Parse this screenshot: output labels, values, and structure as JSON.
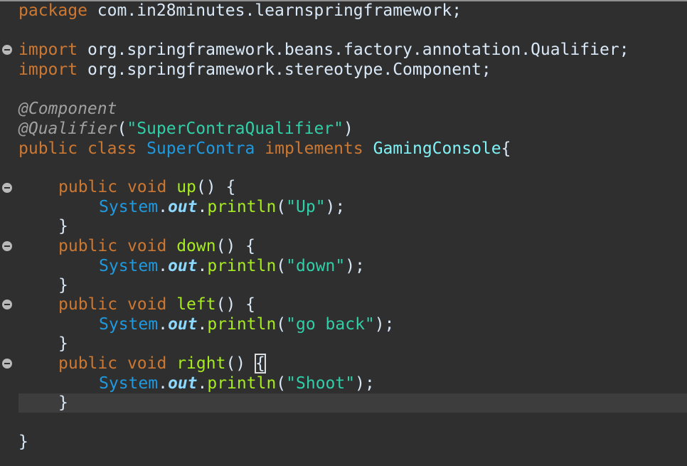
{
  "code": {
    "package_kw": "package",
    "package_name": " com.in28minutes.learnspringframework;",
    "import_kw": "import",
    "import1": " org.springframework.beans.factory.annotation.Qualifier;",
    "import2": " org.springframework.stereotype.Component;",
    "ann_component": "@Component",
    "ann_qualifier": "@Qualifier",
    "qualifier_paren_open": "(",
    "qualifier_value": "\"SuperContraQualifier\"",
    "qualifier_paren_close": ")",
    "public_kw": "public",
    "class_kw": "class",
    "class_name": "SuperContra",
    "implements_kw": "implements",
    "interface_name": "GamingConsole",
    "class_open_brace": "{",
    "void_kw": "void",
    "system": "System",
    "dot": ".",
    "out": "out",
    "println": "println",
    "paren_open": "(",
    "stmt_end": ");",
    "close_brace": "}",
    "methods": [
      {
        "name": "up",
        "sig_tail": "() {",
        "message": "\"Up\""
      },
      {
        "name": "down",
        "sig_tail": "() {",
        "message": "\"down\""
      },
      {
        "name": "left",
        "sig_tail": "() {",
        "message": "\"go back\""
      },
      {
        "name": "right",
        "sig_tail": "() ",
        "open_brace": "{",
        "message": "\"Shoot\""
      }
    ]
  },
  "colors": {
    "background": "#2f2f2f",
    "keyword": "#cc7832",
    "type": "#1e9ae0",
    "interface": "#80f2f6",
    "annotation": "#a0a0a0",
    "string": "#30cfa8",
    "method": "#a7ec21",
    "field": "#8dd9ff",
    "plain": "#d9e8f7"
  },
  "icons": {
    "fold": "collapse-minus-icon"
  }
}
